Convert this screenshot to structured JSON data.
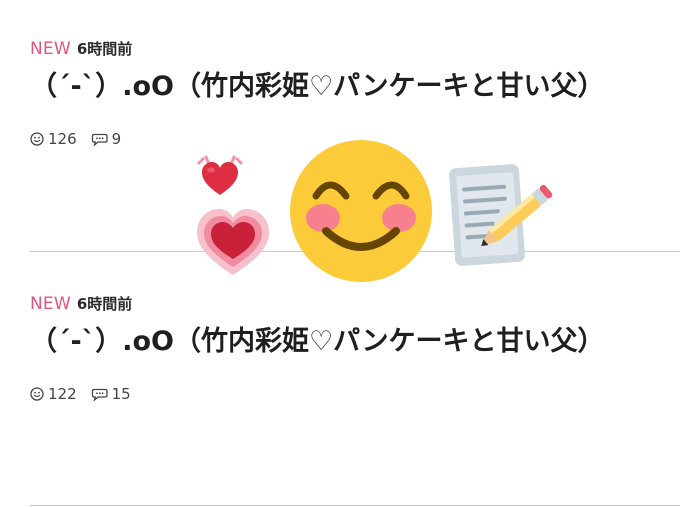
{
  "entries": [
    {
      "badge": "NEW",
      "time": "6時間前",
      "title": "（´-`）.oO（竹内彩姫♡パンケーキと甘い父）",
      "likes": "126",
      "comments": "9"
    },
    {
      "badge": "NEW",
      "time": "6時間前",
      "title": "（´-`）.oO（竹内彩姫♡パンケーキと甘い父）",
      "likes": "122",
      "comments": "15"
    }
  ],
  "icons": {
    "like": "smiley-face-icon",
    "comment": "speech-bubble-icon"
  },
  "overlay_emojis": [
    "beating-heart-emoji",
    "growing-heart-emoji",
    "smiling-face-with-smiling-eyes-emoji",
    "memo-emoji"
  ],
  "colors": {
    "new_badge": "#e5557d",
    "divider": "#c9c9c9",
    "emoji_yellow": "#fccb3a",
    "heart_red": "#dd2e44"
  }
}
